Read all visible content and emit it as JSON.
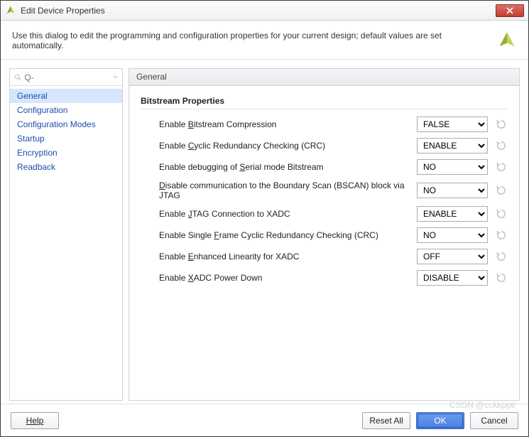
{
  "window": {
    "title": "Edit Device Properties"
  },
  "description": "Use this dialog to edit the programming and configuration properties for your current design; default values are set automatically.",
  "sidebar": {
    "search_placeholder": "Q-",
    "items": [
      {
        "label": "General",
        "selected": true
      },
      {
        "label": "Configuration",
        "selected": false
      },
      {
        "label": "Configuration Modes",
        "selected": false
      },
      {
        "label": "Startup",
        "selected": false
      },
      {
        "label": "Encryption",
        "selected": false
      },
      {
        "label": "Readback",
        "selected": false
      }
    ]
  },
  "main": {
    "header": "General",
    "section_title": "Bitstream Properties",
    "properties": [
      {
        "label_pre": "Enable ",
        "mn": "B",
        "label_post": "itstream Compression",
        "value": "FALSE"
      },
      {
        "label_pre": "Enable ",
        "mn": "C",
        "label_post": "yclic Redundancy Checking (CRC)",
        "value": "ENABLE"
      },
      {
        "label_pre": "Enable debugging of ",
        "mn": "S",
        "label_post": "erial mode Bitstream",
        "value": "NO"
      },
      {
        "label_pre": "",
        "mn": "D",
        "label_post": "isable communication to the Boundary Scan (BSCAN) block via JTAG",
        "value": "NO"
      },
      {
        "label_pre": "Enable ",
        "mn": "J",
        "label_post": "TAG Connection to XADC",
        "value": "ENABLE"
      },
      {
        "label_pre": "Enable Single ",
        "mn": "F",
        "label_post": "rame Cyclic Redundancy Checking (CRC)",
        "value": "NO"
      },
      {
        "label_pre": "Enable ",
        "mn": "E",
        "label_post": "nhanced Linearity for XADC",
        "value": "OFF"
      },
      {
        "label_pre": "Enable ",
        "mn": "X",
        "label_post": "ADC Power Down",
        "value": "DISABLE"
      }
    ]
  },
  "footer": {
    "help": "Help",
    "reset_all": "Reset All",
    "ok": "OK",
    "cancel": "Cancel"
  },
  "watermark": "CSDN @cckkpptr"
}
